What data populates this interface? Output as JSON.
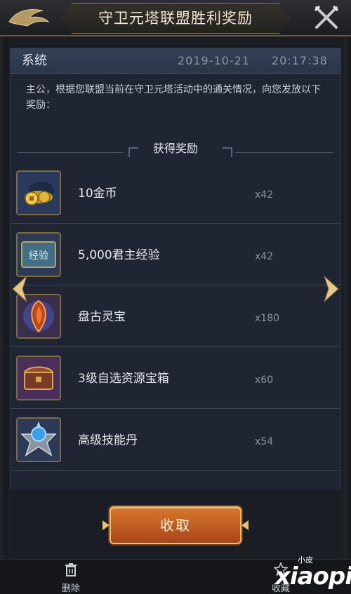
{
  "window": {
    "title": "守卫元塔联盟胜利奖励"
  },
  "mail": {
    "sender": "系统",
    "date": "2019-10-21",
    "time": "20:17:38",
    "body": "主公，根据您联盟当前在守卫元塔活动中的通关情况，向您发放以下奖励："
  },
  "rewards_section": {
    "title": "获得奖励",
    "items": [
      {
        "name": "10金币",
        "count": "x42",
        "icon": "gold-coin-icon"
      },
      {
        "name": "5,000君主经验",
        "count": "x42",
        "icon": "experience-book-icon",
        "icon_text": "经验"
      },
      {
        "name": "盘古灵宝",
        "count": "x180",
        "icon": "red-gem-icon"
      },
      {
        "name": "3级自选资源宝箱",
        "count": "x60",
        "icon": "resource-chest-icon"
      },
      {
        "name": "高级技能丹",
        "count": "x54",
        "icon": "skill-pill-icon"
      },
      {
        "name": "",
        "count": "",
        "icon": "red-chest-icon"
      }
    ]
  },
  "actions": {
    "claim_label": "收取",
    "delete_label": "删除",
    "favorite_label": "收藏"
  },
  "watermark": {
    "small": "小皮",
    "big": "xiaopi"
  },
  "colors": {
    "panel_bg": "#1f2533",
    "header_bg": "#2f3c52",
    "gold_border": "#7d6a43",
    "button_orange": "#c4622a"
  }
}
